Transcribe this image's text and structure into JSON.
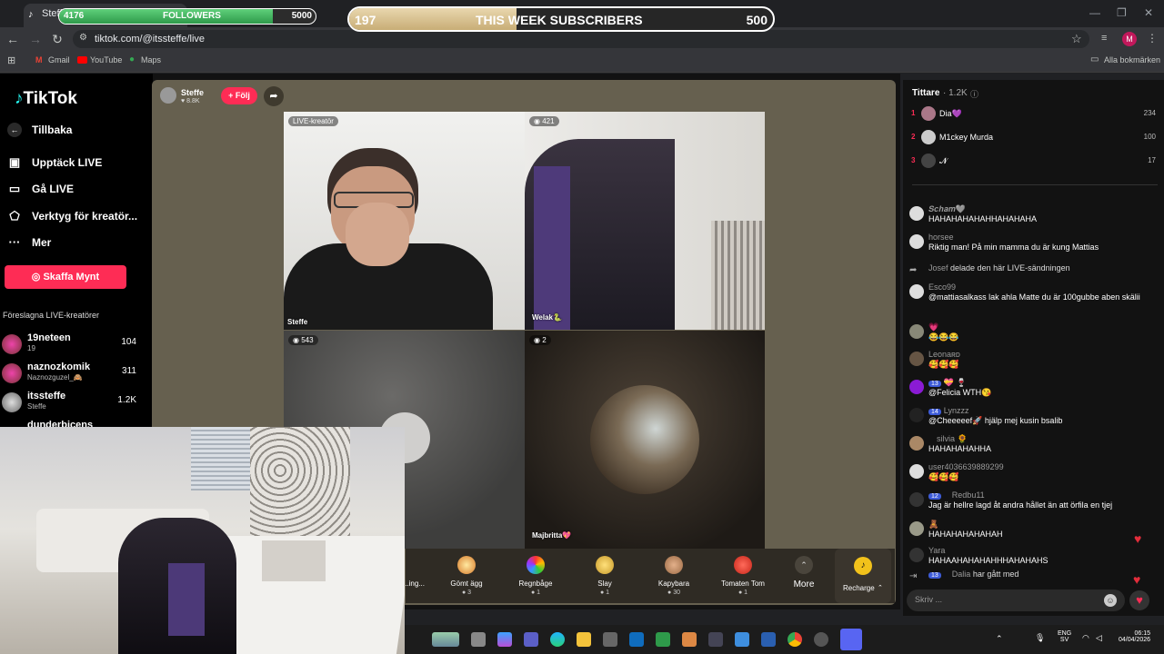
{
  "browser": {
    "tab_title": "Steffe",
    "url": "tiktok.com/@itssteffe/live",
    "bookmarks": [
      "Gmail",
      "YouTube",
      "Maps"
    ],
    "all_bookmarks": "Alla bokmärken",
    "profile_initial": "M"
  },
  "overlay": {
    "followers": {
      "current": "4176",
      "label": "FOLLOWERS",
      "goal": "5000",
      "progress": 0.835
    },
    "subscribers": {
      "current": "197",
      "label": "THIS WEEK SUBSCRIBERS",
      "goal": "500",
      "progress": 0.394
    }
  },
  "sidebar": {
    "logo": "TikTok",
    "back": "Tillbaka",
    "items": [
      {
        "label": "Upptäck LIVE",
        "icon": "live-tv-icon"
      },
      {
        "label": "Gå LIVE",
        "icon": "camera-icon"
      },
      {
        "label": "Verktyg för kreatör...",
        "icon": "tools-icon"
      },
      {
        "label": "Mer",
        "icon": "more-icon"
      }
    ],
    "coins_button": "Skaffa Mynt",
    "suggested_heading": "Föreslagna LIVE-kreatörer",
    "creators": [
      {
        "name": "19neteen",
        "sub": "19",
        "count": "104"
      },
      {
        "name": "naznozkomik",
        "sub": "Naznozguzel_🙈",
        "count": "311"
      },
      {
        "name": "itssteffe",
        "sub": "Steffe",
        "count": "1.2K"
      },
      {
        "name": "dunderbicens",
        "sub": "",
        "count": ""
      }
    ]
  },
  "stream": {
    "host_name": "Steffe",
    "host_likes": "♥ 8.8K",
    "follow_button": "+ Följ",
    "tiles": [
      {
        "badge": "LIVE-kreatör",
        "label": "Steffe"
      },
      {
        "badge": "421",
        "label": "Welak🐍"
      },
      {
        "badge": "543",
        "label": ""
      },
      {
        "badge": "2",
        "label": "Majbritta💖"
      }
    ],
    "gifts": [
      {
        "name": "...ing...",
        "price": ""
      },
      {
        "name": "Gömt ägg",
        "price": "3"
      },
      {
        "name": "Regnbåge",
        "price": "1"
      },
      {
        "name": "Slay",
        "price": "1"
      },
      {
        "name": "Kapybara",
        "price": "30"
      },
      {
        "name": "Tomaten Tom",
        "price": "1"
      }
    ],
    "more_label": "More",
    "recharge_label": "Recharge"
  },
  "chat": {
    "viewers_title": "Tittare",
    "viewers_count": "· 1.2K",
    "top_viewers": [
      {
        "rank": "1",
        "name": "Dia💜",
        "score": "234"
      },
      {
        "rank": "2",
        "name": "M1ckey Murda",
        "score": "100"
      },
      {
        "rank": "3",
        "name": "𝓝",
        "score": "17"
      }
    ],
    "messages": [
      {
        "user": "𝑺𝒄𝒉𝒂𝒎🩶",
        "text": "HAHAHAHAHAHHAHAHAHA",
        "badges": []
      },
      {
        "user": "horsee",
        "text": "Riktig man! På min mamma du är kung Mattias",
        "badges": []
      },
      {
        "user": "Josef",
        "text": "delade den här LIVE-sändningen",
        "badges": [],
        "inline": true
      },
      {
        "user": "Esco99",
        "text": "@mattiasalkass lak ahla Matte du är 100gubbe aben skälii",
        "badges": []
      },
      {
        "user": "💗",
        "text": "😂😂😂",
        "badges": []
      },
      {
        "user": "Leonaʀᴅ",
        "text": "🥰🥰🥰",
        "badges": []
      },
      {
        "user": "💝 🍷",
        "text": "@Felicia WTH😘",
        "badges": [
          "13"
        ]
      },
      {
        "user": "Lynzzz",
        "text": "@Cheeeeef🚀 hjälp mej kusin bsalib",
        "badges": [
          "14"
        ]
      },
      {
        "user": "silvia 🌻",
        "text": "HAHAHAHAHHA",
        "badges": [
          ""
        ]
      },
      {
        "user": "user4036639889299",
        "text": "🥰🥰🥰",
        "badges": []
      },
      {
        "user": "Redbu11",
        "text": "Jag är hellre lagd åt andra hållet än att örfila en tjej",
        "badges": [
          "12",
          ""
        ]
      },
      {
        "user": "🧸",
        "text": "HAHAHAHAHAHAH",
        "badges": []
      },
      {
        "user": "Yara",
        "text": "HAHAAHAHAHAHHHAHAHAHS",
        "badges": []
      },
      {
        "user": "Dalia",
        "text": "har gått med",
        "badges": [
          "13",
          ""
        ],
        "inline": true
      }
    ],
    "input_placeholder": "Skriv ..."
  },
  "taskbar": {
    "lang": "ENG",
    "lang_sub": "SV",
    "time": "06:15",
    "date": "04/04/2026"
  },
  "colors": {
    "accent": "#fe2c55",
    "stage": "#66604f",
    "followers_fill": "#3fb45d",
    "subs_fill": "#d8c08e"
  }
}
